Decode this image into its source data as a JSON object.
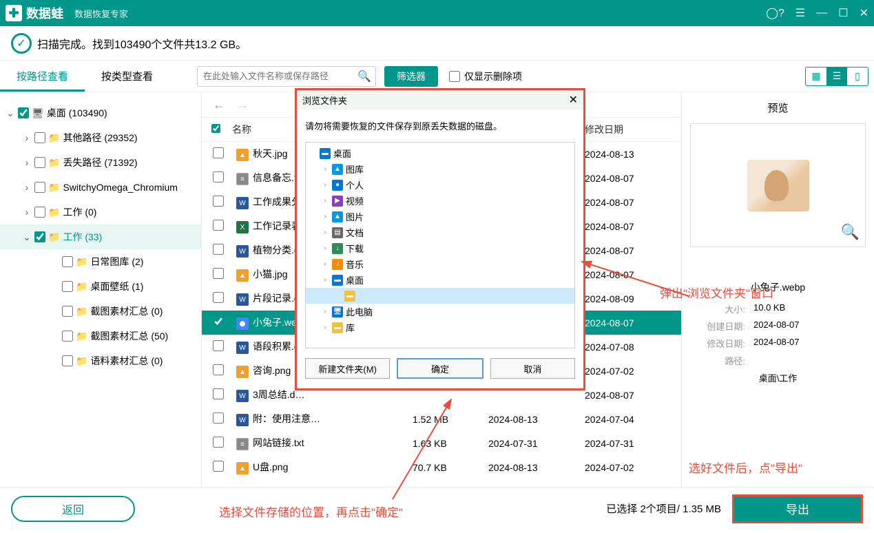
{
  "app": {
    "name": "数据蛙",
    "subtitle": "数据恢复专家"
  },
  "status": {
    "text": "扫描完成。找到103490个文件共13.2 GB。"
  },
  "tabs": {
    "byPath": "按路径查看",
    "byType": "按类型查看"
  },
  "search": {
    "placeholder": "在此处输入文件名称或保存路径"
  },
  "toolbar": {
    "filter": "筛选器",
    "showDeletedOnly": "仅显示删除项"
  },
  "tree": [
    {
      "label": "桌面 (103490)",
      "indent": 0,
      "expanded": true,
      "icon": "display",
      "checked": true
    },
    {
      "label": "其他路径 (29352)",
      "indent": 1,
      "expanded": false,
      "icon": "folder"
    },
    {
      "label": "丢失路径 (71392)",
      "indent": 1,
      "expanded": false,
      "icon": "folder"
    },
    {
      "label": "SwitchyOmega_Chromium",
      "indent": 1,
      "expanded": false,
      "icon": "folder"
    },
    {
      "label": "工作 (0)",
      "indent": 1,
      "expanded": false,
      "icon": "folder"
    },
    {
      "label": "工作 (33)",
      "indent": 1,
      "expanded": true,
      "icon": "folder",
      "checked": true,
      "selected": true
    },
    {
      "label": "日常图库 (2)",
      "indent": 2,
      "icon": "folder"
    },
    {
      "label": "桌面壁纸 (1)",
      "indent": 2,
      "icon": "folder"
    },
    {
      "label": "截图素材汇总 (0)",
      "indent": 2,
      "icon": "folder"
    },
    {
      "label": "截图素材汇总 (50)",
      "indent": 2,
      "icon": "folder"
    },
    {
      "label": "语料素材汇总 (0)",
      "indent": 2,
      "icon": "folder"
    }
  ],
  "headers": {
    "name": "名称",
    "modDate": "修改日期"
  },
  "files": [
    {
      "name": "秋天.jpg",
      "ico": "img",
      "size": "",
      "date1": "",
      "date2": "2024-08-13"
    },
    {
      "name": "信息备忘.t…",
      "ico": "txt",
      "size": "",
      "date1": "",
      "date2": "2024-08-07"
    },
    {
      "name": "工作成果分…",
      "ico": "doc",
      "size": "",
      "date1": "",
      "date2": "2024-08-07"
    },
    {
      "name": "工作记录表…",
      "ico": "xls",
      "size": "",
      "date1": "",
      "date2": "2024-08-07"
    },
    {
      "name": "植物分类.d…",
      "ico": "doc",
      "size": "",
      "date1": "",
      "date2": "2024-08-07"
    },
    {
      "name": "小猫.jpg",
      "ico": "img",
      "size": "",
      "date1": "",
      "date2": "2024-08-07"
    },
    {
      "name": "片段记录.d…",
      "ico": "doc",
      "size": "",
      "date1": "",
      "date2": "2024-08-09"
    },
    {
      "name": "小兔子.we…",
      "ico": "chrome",
      "size": "",
      "date1": "",
      "date2": "2024-08-07",
      "selected": true,
      "checked": true
    },
    {
      "name": "语段积累.d…",
      "ico": "doc",
      "size": "",
      "date1": "",
      "date2": "2024-07-08"
    },
    {
      "name": "咨询.png",
      "ico": "img",
      "size": "",
      "date1": "",
      "date2": "2024-07-02"
    },
    {
      "name": "3周总结.d…",
      "ico": "doc",
      "size": "",
      "date1": "",
      "date2": "2024-08-07"
    },
    {
      "name": "附：使用注意…",
      "ico": "doc",
      "size": "1.52 MB",
      "date1": "2024-08-13",
      "date2": "2024-07-04"
    },
    {
      "name": "网站链接.txt",
      "ico": "txt",
      "size": "1.63 KB",
      "date1": "2024-07-31",
      "date2": "2024-07-31"
    },
    {
      "name": "U盘.png",
      "ico": "img",
      "size": "70.7 KB",
      "date1": "2024-08-13",
      "date2": "2024-07-02"
    }
  ],
  "preview": {
    "title": "预览",
    "filename": "小兔子.webp",
    "sizeLabel": "大小:",
    "size": "10.0 KB",
    "createdLabel": "创建日期:",
    "created": "2024-08-07",
    "modifiedLabel": "修改日期:",
    "modified": "2024-08-07",
    "pathLabel": "路径:",
    "path": "桌面\\工作"
  },
  "footer": {
    "back": "返回",
    "status": "已选择 2个项目/ 1.35 MB",
    "export": "导出"
  },
  "dialog": {
    "title": "浏览文件夹",
    "message": "请勿将需要恢复的文件保存到原丢失数据的磁盘。",
    "items": [
      {
        "label": "桌面",
        "indent": 0,
        "ico": "desktop"
      },
      {
        "label": "图库",
        "indent": 1,
        "ico": "pic",
        "exp": "›"
      },
      {
        "label": "个人",
        "indent": 1,
        "ico": "user",
        "exp": "›",
        "blur": true
      },
      {
        "label": "视频",
        "indent": 1,
        "ico": "video",
        "exp": "›"
      },
      {
        "label": "图片",
        "indent": 1,
        "ico": "pic",
        "exp": "›"
      },
      {
        "label": "文档",
        "indent": 1,
        "ico": "docf",
        "exp": "›"
      },
      {
        "label": "下载",
        "indent": 1,
        "ico": "down",
        "exp": "›"
      },
      {
        "label": "音乐",
        "indent": 1,
        "ico": "music",
        "exp": "›"
      },
      {
        "label": "桌面",
        "indent": 1,
        "ico": "desktop",
        "exp": "›"
      },
      {
        "label": "",
        "indent": 2,
        "ico": "folder",
        "blur": true,
        "selected": true
      },
      {
        "label": "此电脑",
        "indent": 1,
        "ico": "pc",
        "exp": "›"
      },
      {
        "label": "库",
        "indent": 1,
        "ico": "folder",
        "exp": "›"
      }
    ],
    "newFolder": "新建文件夹(M)",
    "ok": "确定",
    "cancel": "取消"
  },
  "annotations": {
    "a1": "弹出\"浏览文件夹\"窗口",
    "a2": "选择文件存储的位置，再点击\"确定\"",
    "a3": "选好文件后，点\"导出\""
  }
}
